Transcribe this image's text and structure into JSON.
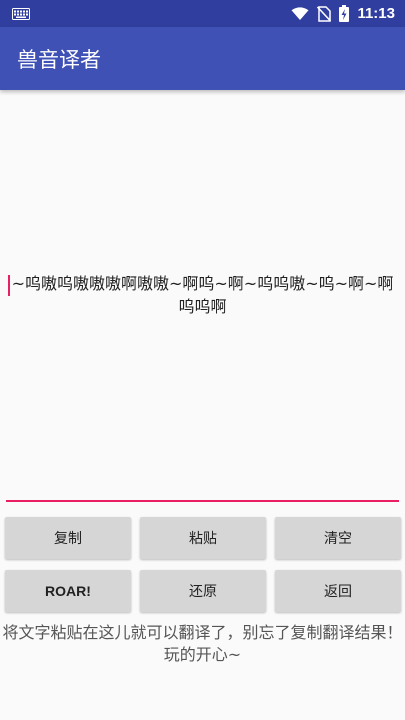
{
  "status_bar": {
    "time": "11:13",
    "icons": [
      "keyboard-icon",
      "wifi-icon",
      "no-sim-icon",
      "battery-charging-icon"
    ]
  },
  "app_bar": {
    "title": "兽音译者"
  },
  "editor": {
    "text": "~呜嗷呜嗷嗷嗷啊嗷嗷~啊呜~啊~呜呜嗷~呜~啊~啊呜呜啊"
  },
  "buttons": {
    "copy": "复制",
    "paste": "粘贴",
    "clear": "清空",
    "roar": "ROAR!",
    "restore": "还原",
    "back": "返回"
  },
  "hint": "将文字粘贴在这儿就可以翻译了，别忘了复制翻译结果！玩的开心~",
  "colors": {
    "status_bar": "#303f9f",
    "app_bar": "#3f51b5",
    "accent": "#e91e63",
    "button_bg": "#d6d6d6"
  }
}
